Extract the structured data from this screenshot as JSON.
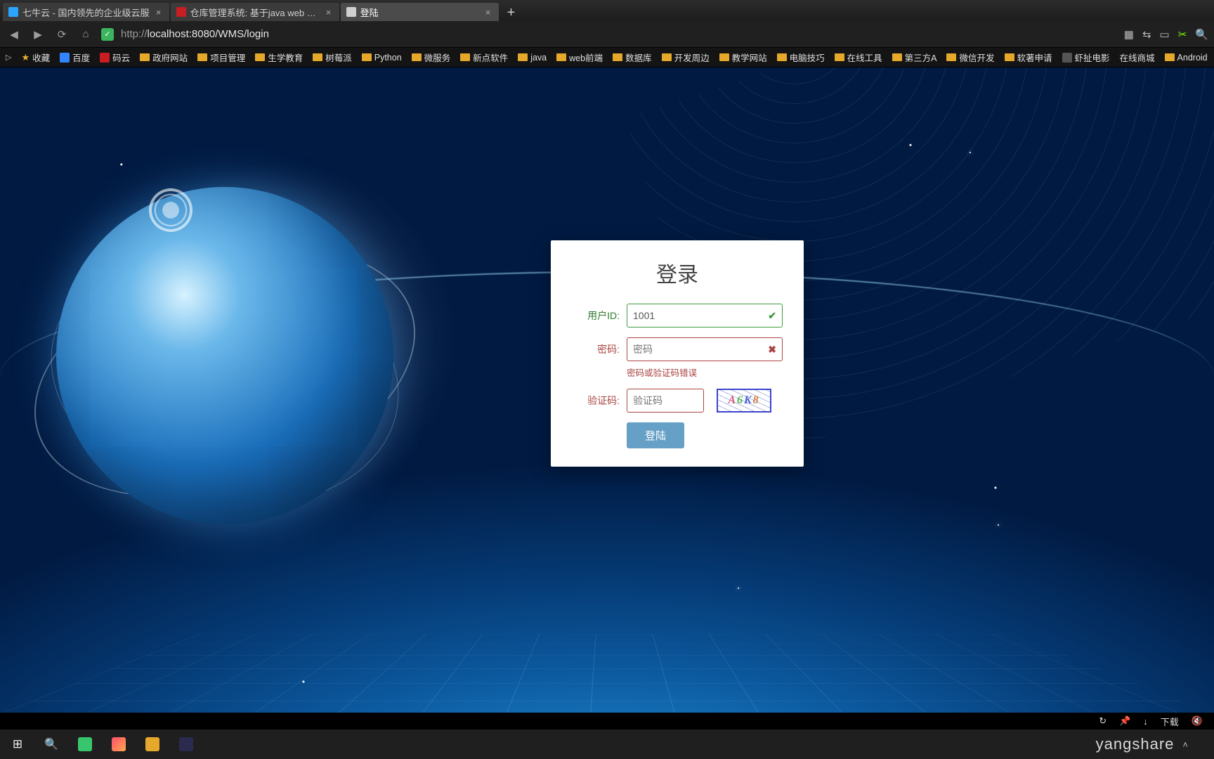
{
  "browser": {
    "tabs": [
      {
        "title": "七牛云 - 国内领先的企业级云服",
        "favcolor": "#2aa4ff"
      },
      {
        "title": "仓库管理系统: 基于java web SSM",
        "favcolor": "#c71d23"
      },
      {
        "title": "登陆",
        "favcolor": "#cfcfcf"
      }
    ],
    "active_tab": 2,
    "url_scheme": "http://",
    "url_rest": "localhost:8080/WMS/login",
    "bookmarks": [
      "收藏",
      "百度",
      "码云",
      "政府网站",
      "项目管理",
      "生学教育",
      "树莓派",
      "Python",
      "微服务",
      "新点软件",
      "java",
      "web前端",
      "数据库",
      "开发周边",
      "教学网站",
      "电脑技巧",
      "在线工具",
      "第三方A",
      "微信开发",
      "软著申请",
      "虾扯电影",
      "在线商城",
      "Android"
    ],
    "status_download": "下载"
  },
  "login": {
    "title": "登录",
    "user_label": "用户ID:",
    "user_value": "1001",
    "pwd_label": "密码:",
    "pwd_placeholder": "密码",
    "pwd_value": "",
    "error_msg": "密码或验证码错误",
    "captcha_label": "验证码:",
    "captcha_placeholder": "验证码",
    "captcha_text": [
      "A",
      "6",
      "K",
      "8"
    ],
    "submit": "登陆"
  },
  "taskbar": {
    "watermark": "yangshare"
  },
  "colors": {
    "success": "#3c9a3c",
    "error": "#a94442",
    "primary_btn": "#66a0c7"
  }
}
